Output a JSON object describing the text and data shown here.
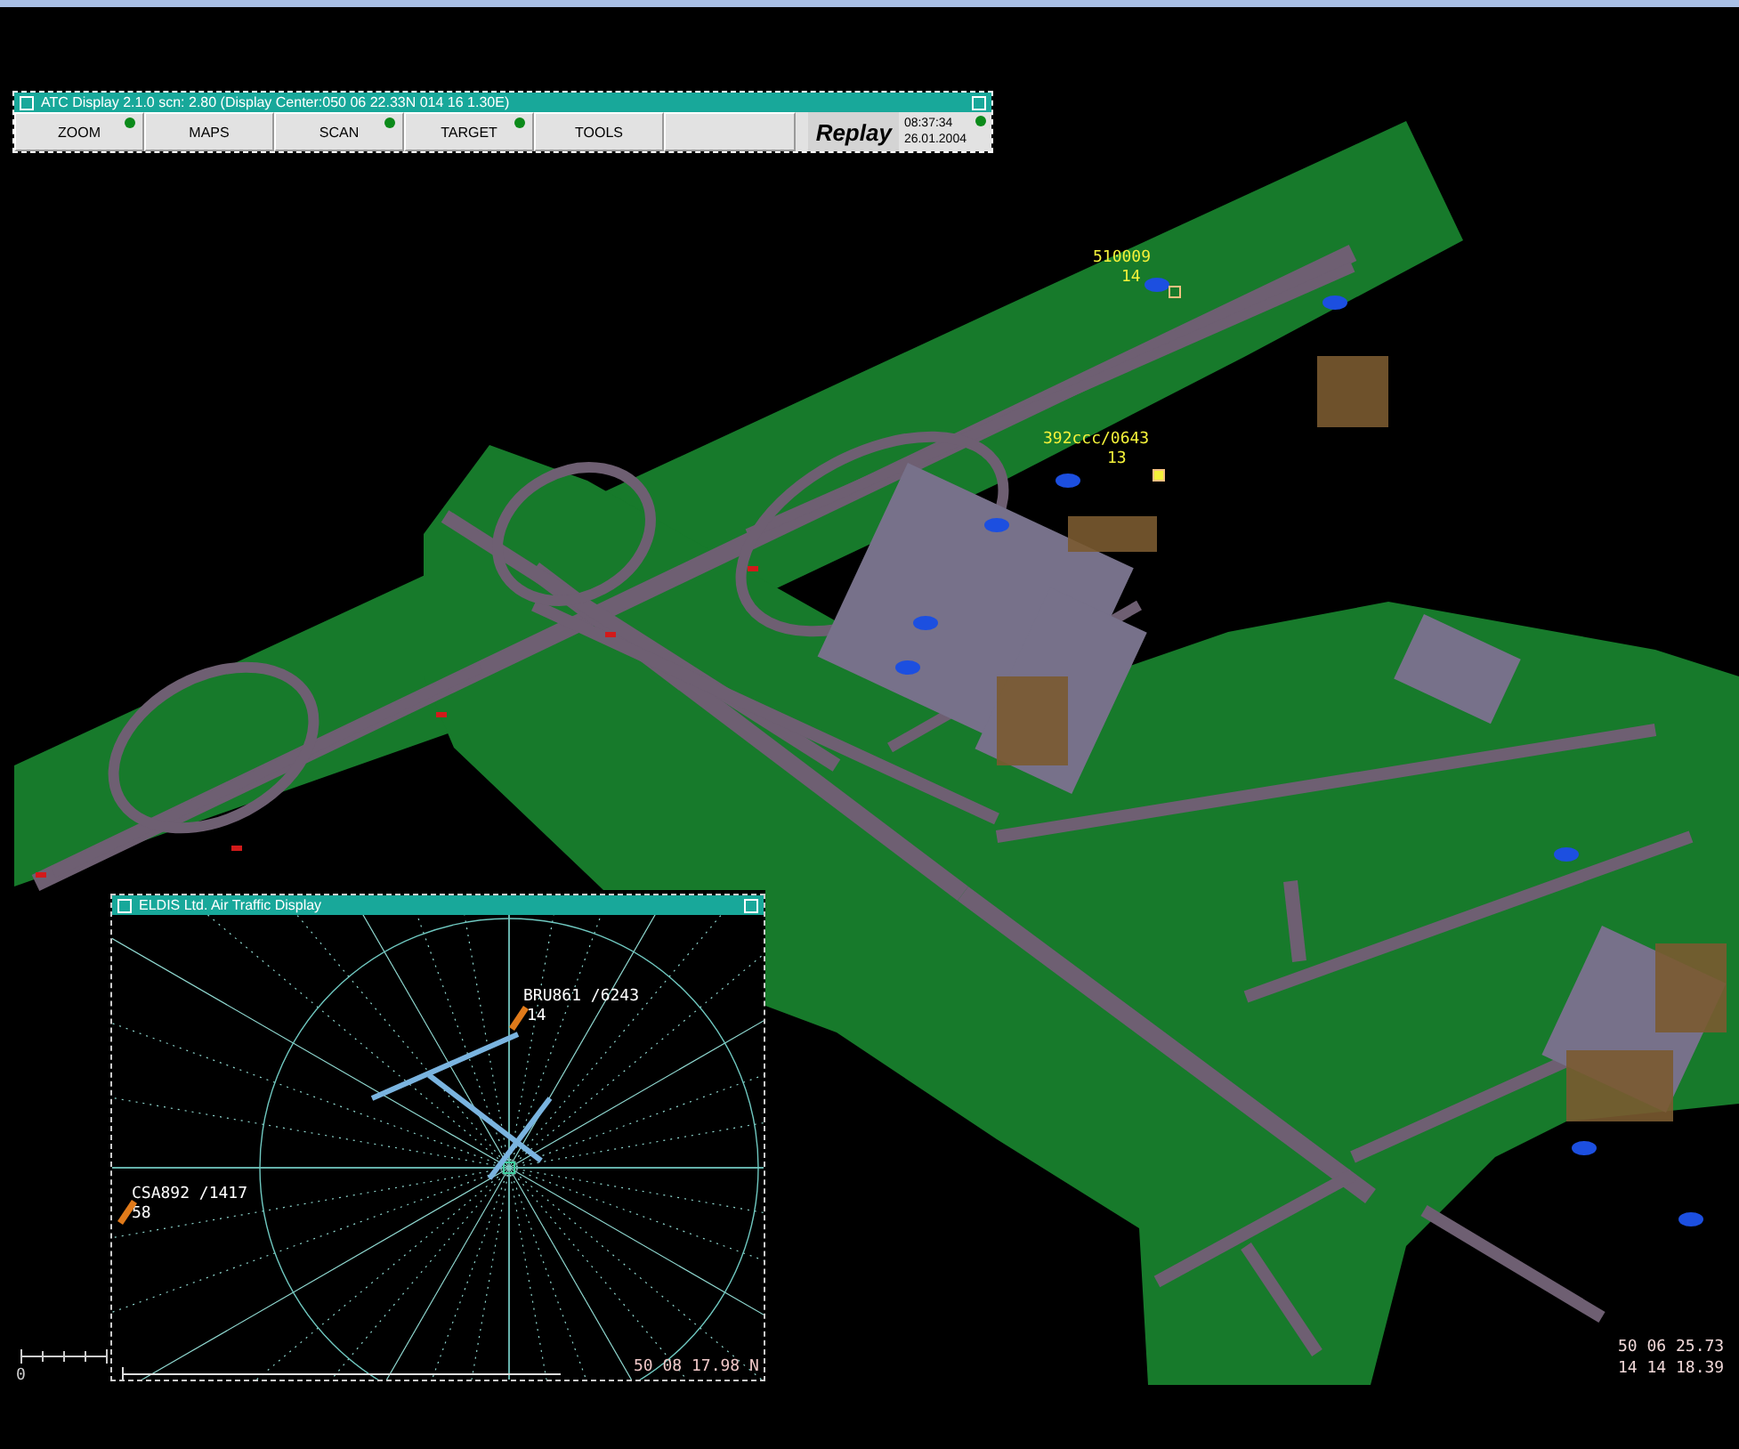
{
  "toolbar": {
    "title": "ATC Display  2.1.0 scn: 2.80 (Display Center:050 06 22.33N 014 16 1.30E)",
    "buttons": [
      {
        "label": "ZOOM",
        "indicator": true
      },
      {
        "label": "MAPS",
        "indicator": false
      },
      {
        "label": "SCAN",
        "indicator": true
      },
      {
        "label": "TARGET",
        "indicator": true
      },
      {
        "label": "TOOLS",
        "indicator": false
      }
    ],
    "mode": "Replay",
    "time": "08:37:34",
    "date": "26.01.2004",
    "clock_indicator": true
  },
  "map": {
    "targets": [
      {
        "callsign": "510009",
        "altitude": "14"
      },
      {
        "callsign": "392ccc/0643",
        "altitude": "13"
      }
    ],
    "coordinates": [
      "50 06 25.73",
      "14 14 18.39"
    ],
    "scale_label": "0"
  },
  "inset": {
    "title": "ELDIS Ltd. Air Traffic Display",
    "targets": [
      {
        "callsign": "BRU861 /6243",
        "altitude": "14"
      },
      {
        "callsign": "CSA892 /1417",
        "altitude": "58"
      }
    ],
    "coordinate": "50 08 17.98 N"
  }
}
